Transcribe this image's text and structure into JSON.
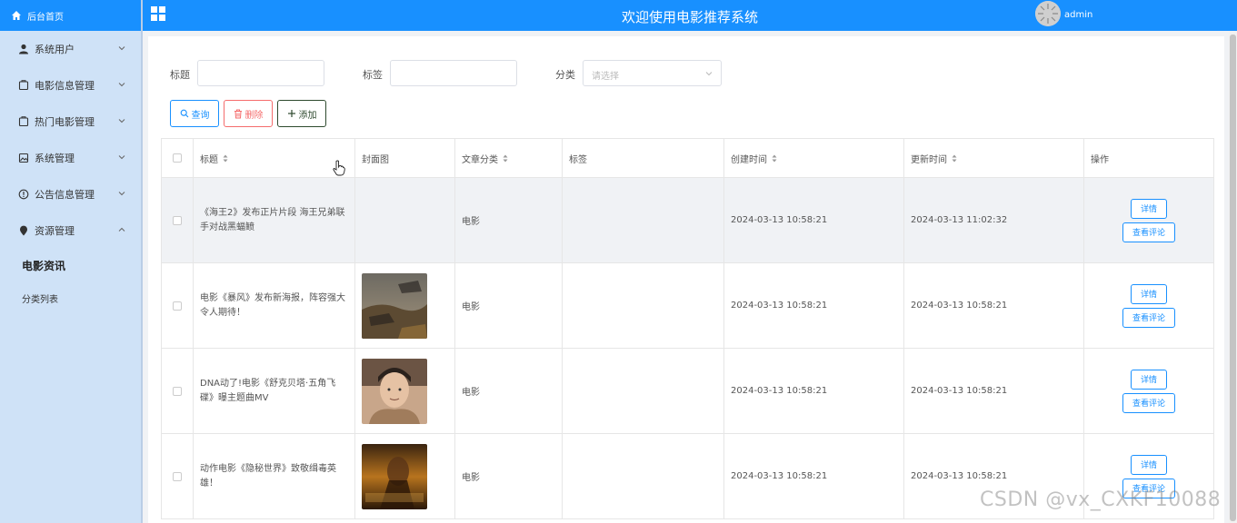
{
  "sidebar": {
    "home_label": "后台首页",
    "menus": [
      {
        "label": "系统用户",
        "icon": "user-icon",
        "expanded": false
      },
      {
        "label": "电影信息管理",
        "icon": "tag-icon",
        "expanded": false
      },
      {
        "label": "热门电影管理",
        "icon": "tag-icon",
        "expanded": false
      },
      {
        "label": "系统管理",
        "icon": "image-icon",
        "expanded": false
      },
      {
        "label": "公告信息管理",
        "icon": "info-circle-icon",
        "expanded": false
      },
      {
        "label": "资源管理",
        "icon": "location-pin-icon",
        "expanded": true
      }
    ],
    "submenu": {
      "active_label": "电影资讯",
      "second_label": "分类列表"
    }
  },
  "header": {
    "title": "欢迎使用电影推荐系统",
    "user": "admin"
  },
  "search": {
    "title_label": "标题",
    "title_value": "",
    "tag_label": "标签",
    "tag_value": "",
    "category_label": "分类",
    "category_placeholder": "请选择"
  },
  "toolbar": {
    "search_label": "查询",
    "delete_label": "删除",
    "add_label": "添加"
  },
  "table": {
    "headers": [
      "标题",
      "封面图",
      "文章分类",
      "标签",
      "创建时间",
      "更新时间",
      "操作"
    ],
    "rows": [
      {
        "title": "《海王2》发布正片片段 海王兄弟联手对战黑蝠鲼",
        "cover": "none",
        "category": "电影",
        "tag": "",
        "created": "2024-03-13 10:58:21",
        "updated": "2024-03-13 11:02:32"
      },
      {
        "title": "电影《暴风》发布新海报，阵容强大令人期待！",
        "cover": "poster-storm",
        "category": "电影",
        "tag": "",
        "created": "2024-03-13 10:58:21",
        "updated": "2024-03-13 10:58:21"
      },
      {
        "title": "DNA动了!电影《舒克贝塔·五角飞碟》曝主题曲MV",
        "cover": "photo-portrait",
        "category": "电影",
        "tag": "",
        "created": "2024-03-13 10:58:21",
        "updated": "2024-03-13 10:58:21"
      },
      {
        "title": "动作电影《隐秘世界》致敬缉毒英雄！",
        "cover": "poster-hidden-world",
        "category": "电影",
        "tag": "",
        "created": "2024-03-13 10:58:21",
        "updated": "2024-03-13 10:58:21"
      }
    ],
    "detail_label": "详情",
    "comment_label": "查看评论"
  },
  "watermark": "CSDN @vx_CXKF10088",
  "colors": {
    "primary": "#1890ff",
    "danger": "#f56c6c",
    "sidebar_bg": "#cfe2f7"
  }
}
